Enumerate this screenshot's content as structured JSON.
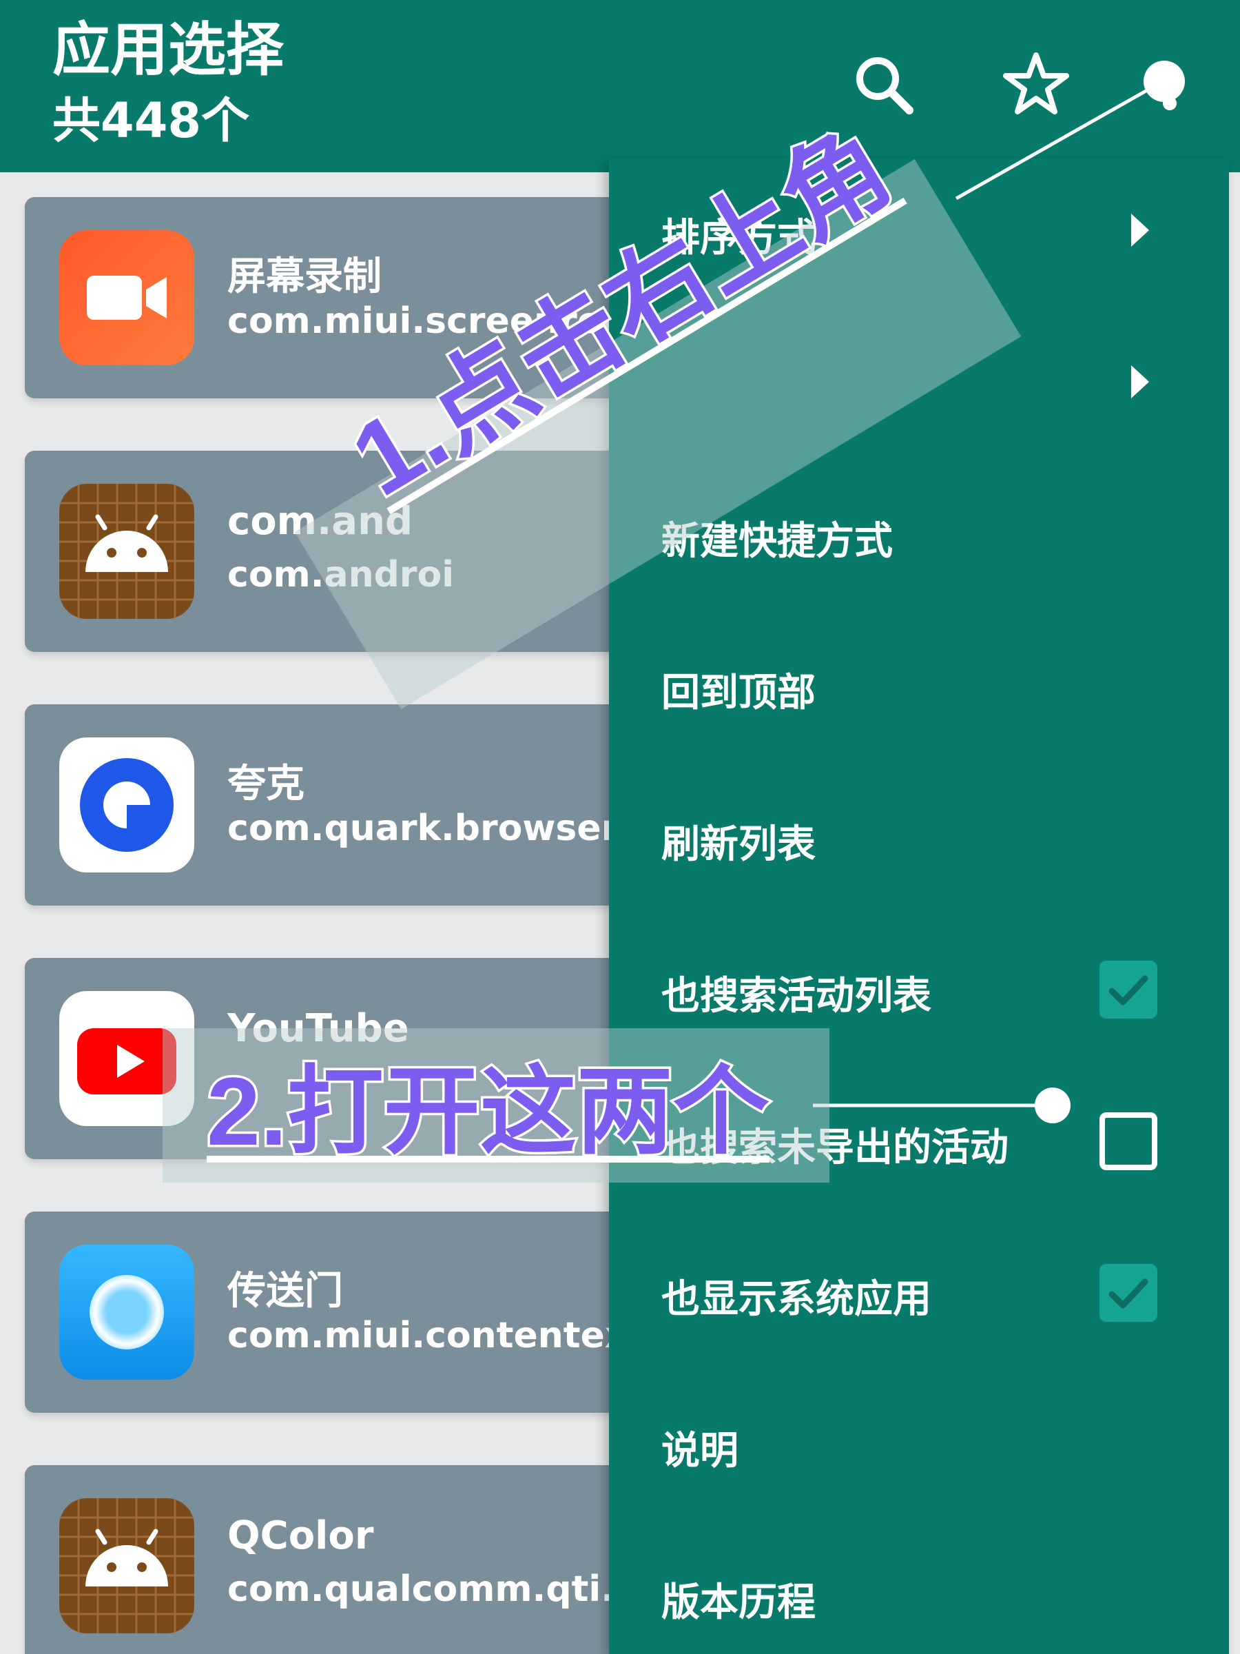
{
  "header": {
    "title": "应用选择",
    "subtitle": "共448个",
    "icons": [
      "search-icon",
      "star-icon",
      "more-icon"
    ]
  },
  "apps": [
    {
      "name": "屏幕录制",
      "package": "com.miui.screenreco",
      "icon": "screen-recorder-icon",
      "icon_color": "#ff6a2f"
    },
    {
      "name": "com.and",
      "package": "com.androi",
      "icon": "android-icon",
      "icon_color": "#7a4a1a"
    },
    {
      "name": "夸克",
      "package": "com.quark.browser",
      "icon": "quark-icon",
      "icon_color": "#1f57e8"
    },
    {
      "name": "YouTube",
      "package": "",
      "icon": "youtube-icon",
      "icon_color": "#ff0000"
    },
    {
      "name": "传送门",
      "package": "com.miui.contentexte",
      "icon": "portal-icon",
      "icon_color": "#1aa7ff"
    },
    {
      "name": "QColor",
      "package": "com.qualcomm.qti.qc",
      "icon": "android-icon",
      "icon_color": "#7a4a1a"
    }
  ],
  "menu": {
    "items": [
      {
        "label": "排序方式",
        "type": "submenu"
      },
      {
        "label": "",
        "type": "submenu"
      },
      {
        "label": "新建快捷方式",
        "type": "action"
      },
      {
        "label": "回到顶部",
        "type": "action"
      },
      {
        "label": "刷新列表",
        "type": "action"
      },
      {
        "label": "也搜索活动列表",
        "type": "checkbox",
        "checked": true
      },
      {
        "label": "也搜索未导出的活动",
        "type": "checkbox",
        "checked": false
      },
      {
        "label": "也显示系统应用",
        "type": "checkbox",
        "checked": true
      },
      {
        "label": "说明",
        "type": "action"
      },
      {
        "label": "版本历程",
        "type": "action"
      }
    ]
  },
  "annotations": {
    "step1": "1.点击右上角",
    "step2": "2.打开这两个"
  },
  "colors": {
    "primary": "#077a6a",
    "card": "#7b8f9a",
    "checkbox_on": "#17a593",
    "annotation_text": "#7d5cf0"
  }
}
